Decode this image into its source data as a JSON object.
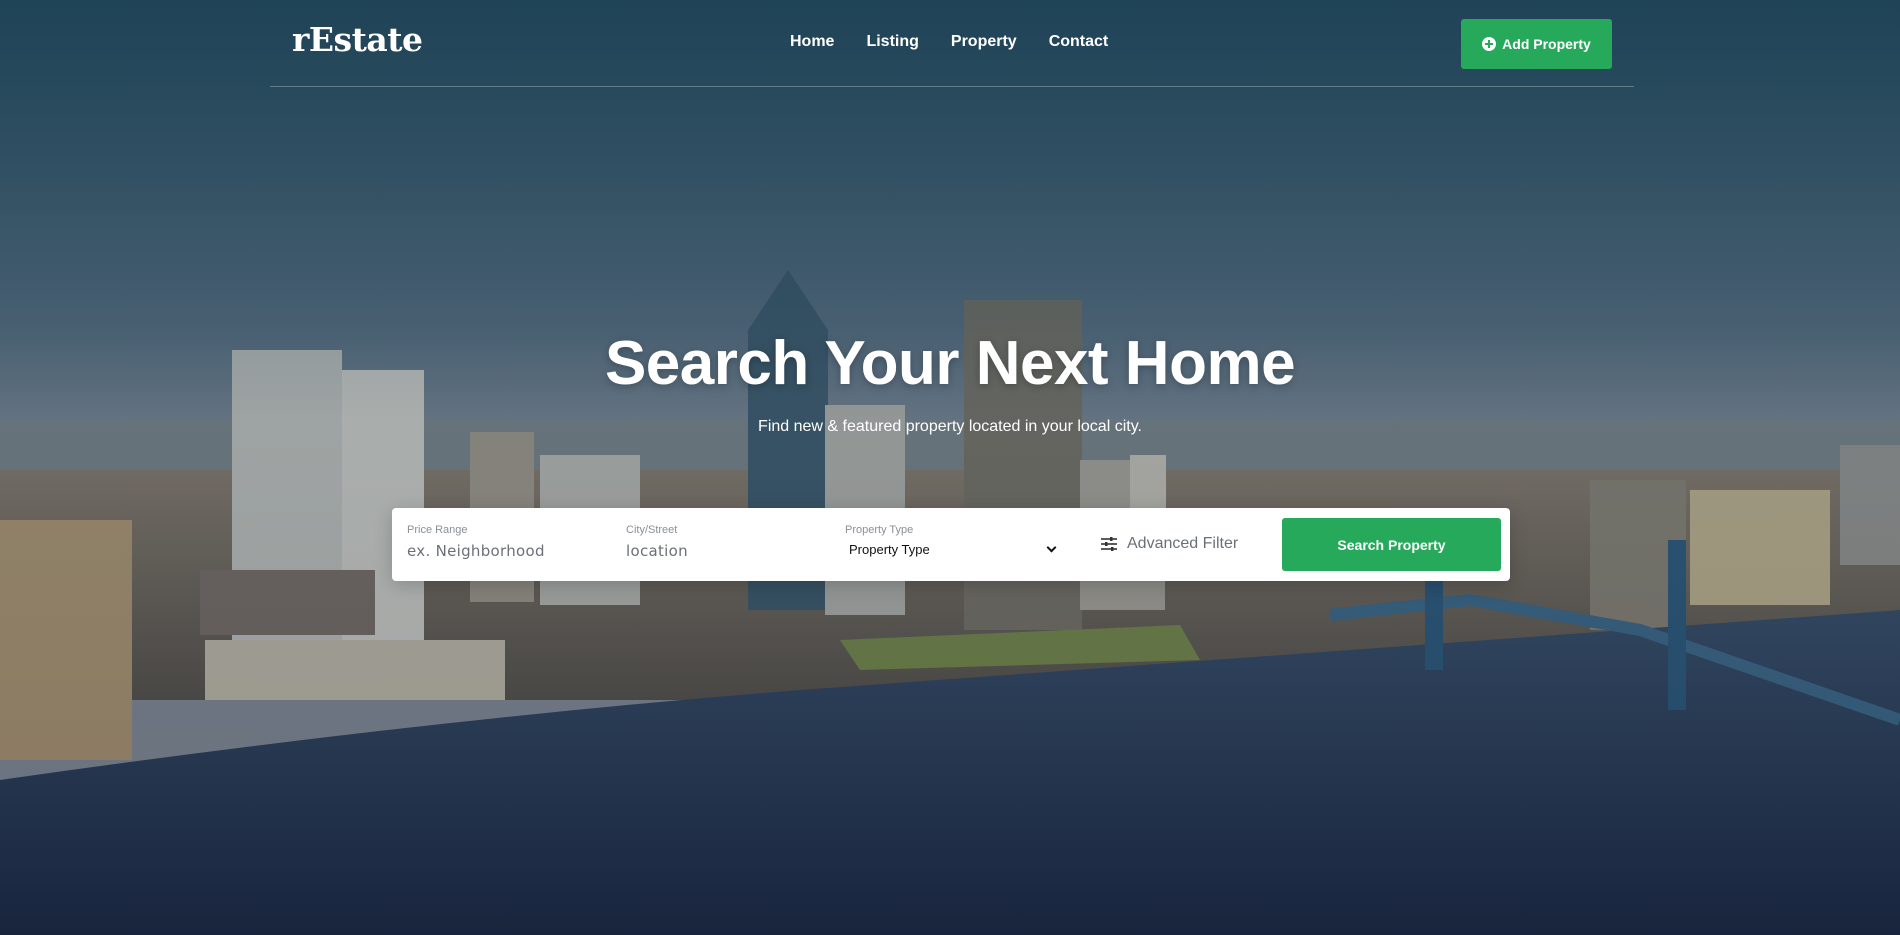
{
  "brand": {
    "logo": "rEstate"
  },
  "nav": {
    "items": [
      "Home",
      "Listing",
      "Property",
      "Contact"
    ]
  },
  "header": {
    "add_property_label": "Add Property",
    "add_icon": "plus-circle-icon"
  },
  "hero": {
    "title": "Search Your Next Home",
    "subtitle": "Find new & featured property located in your local city."
  },
  "search": {
    "price_range": {
      "label": "Price Range",
      "placeholder": "ex. Neighborhood"
    },
    "city_street": {
      "label": "City/Street",
      "placeholder": "location"
    },
    "property_type": {
      "label": "Property Type",
      "selected": "Property Type"
    },
    "advanced_filter_label": "Advanced Filter",
    "advanced_filter_icon": "sliders-icon",
    "submit_label": "Search Property"
  },
  "colors": {
    "accent": "#27a95b",
    "header_text": "#ffffff",
    "input_text": "#6b7078"
  }
}
